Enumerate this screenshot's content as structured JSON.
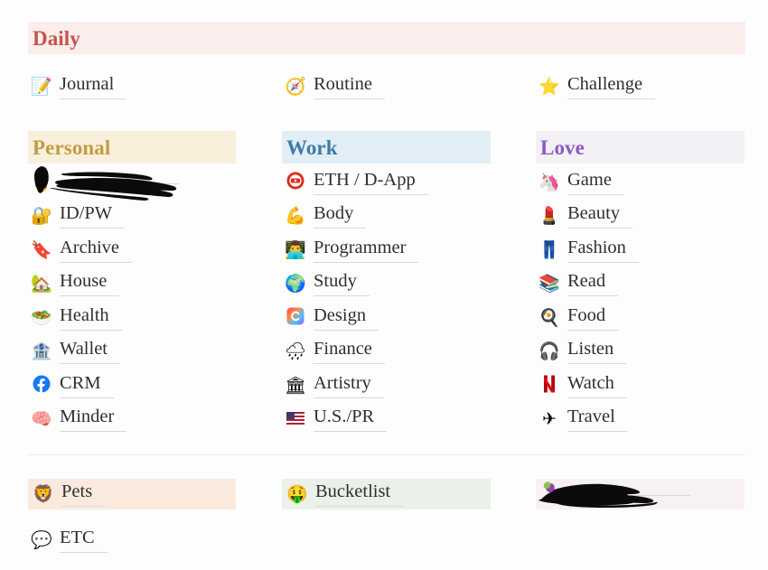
{
  "page": {
    "background": "#fdfdfd"
  },
  "sections": {
    "daily": {
      "title": "Daily",
      "title_color": "#c8534c",
      "bar_color": "#fbeeed",
      "items": [
        {
          "emoji": "📝",
          "icon_name": "memo-icon",
          "label": "Journal"
        },
        {
          "emoji": "🧭",
          "icon_name": "compass-icon",
          "label": "Routine"
        },
        {
          "emoji": "⭐",
          "icon_name": "star-icon",
          "label": "Challenge"
        }
      ]
    },
    "personal": {
      "title": "Personal",
      "title_color": "#c39b46",
      "bar_color": "#f8f0db",
      "items": [
        {
          "emoji": "🏅",
          "icon_name": "redacted-icon",
          "label": "",
          "redacted": true
        },
        {
          "emoji": "🔐",
          "icon_name": "locked-key-icon",
          "label": "ID/PW"
        },
        {
          "emoji": "🔖",
          "icon_name": "bookmark-icon",
          "label": "Archive"
        },
        {
          "emoji": "🏡",
          "icon_name": "house-icon",
          "label": "House"
        },
        {
          "emoji": "🥗",
          "icon_name": "salad-icon",
          "label": "Health"
        },
        {
          "emoji": "🏦",
          "icon_name": "bank-icon",
          "label": "Wallet"
        },
        {
          "emoji": "🅵",
          "icon_name": "facebook-icon",
          "label": "CRM"
        },
        {
          "emoji": "🧠",
          "icon_name": "brain-icon",
          "label": "Minder"
        }
      ]
    },
    "work": {
      "title": "Work",
      "title_color": "#3d7ca8",
      "bar_color": "#e2eef6",
      "items": [
        {
          "emoji": "▶",
          "icon_name": "youtube-play-icon",
          "label": "ETH / D-App"
        },
        {
          "emoji": "💪",
          "icon_name": "flexed-biceps-icon",
          "label": "Body"
        },
        {
          "emoji": "👨‍💻",
          "icon_name": "technologist-icon",
          "label": "Programmer"
        },
        {
          "emoji": "🌍",
          "icon_name": "globe-icon",
          "label": "Study"
        },
        {
          "emoji": "🎨",
          "icon_name": "creative-cloud-icon",
          "label": "Design"
        },
        {
          "emoji": "🌧",
          "icon_name": "rain-cloud-icon",
          "label": "Finance"
        },
        {
          "emoji": "🏛",
          "icon_name": "classical-building-icon",
          "label": "Artistry"
        },
        {
          "emoji": "🇺🇸",
          "icon_name": "us-flag-icon",
          "label": "U.S./PR"
        }
      ]
    },
    "love": {
      "title": "Love",
      "title_color": "#8c59c4",
      "bar_color": "#f3f0f6",
      "items": [
        {
          "emoji": "🦄",
          "icon_name": "unicorn-icon",
          "label": "Game"
        },
        {
          "emoji": "💄",
          "icon_name": "lipstick-icon",
          "label": "Beauty"
        },
        {
          "emoji": "👖",
          "icon_name": "jeans-icon",
          "label": "Fashion"
        },
        {
          "emoji": "📚",
          "icon_name": "books-icon",
          "label": "Read"
        },
        {
          "emoji": "🍳",
          "icon_name": "cooking-pan-icon",
          "label": "Food"
        },
        {
          "emoji": "🎧",
          "icon_name": "headphones-icon",
          "label": "Listen"
        },
        {
          "emoji": "™",
          "icon_name": "netflix-icon",
          "label": "Watch"
        },
        {
          "emoji": "✈",
          "icon_name": "airplane-icon",
          "label": "Travel"
        }
      ]
    }
  },
  "bottom": {
    "pets": {
      "emoji": "🦁",
      "icon_name": "lion-icon",
      "label": "Pets",
      "bar_color": "#faeade"
    },
    "bucketlist": {
      "emoji": "🤑",
      "icon_name": "money-mouth-face-icon",
      "label": "Bucketlist",
      "bar_color": "#eaf1e8"
    },
    "hidden": {
      "emoji": "",
      "icon_name": "redacted-icon",
      "label": "",
      "bar_color": "#f7f1f3",
      "redacted": true
    },
    "etc": {
      "emoji": "💬",
      "icon_name": "speech-balloon-icon",
      "label": "ETC"
    }
  }
}
